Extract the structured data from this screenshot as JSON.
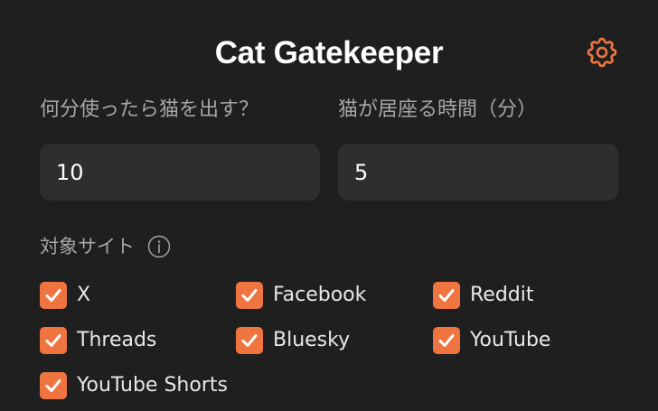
{
  "app": {
    "title": "Cat Gatekeeper",
    "accent_color": "#f07440",
    "settings_icon": "gear-icon"
  },
  "fields": {
    "interval": {
      "label": "何分使ったら猫を出す？",
      "value": "10"
    },
    "duration": {
      "label": "猫が居座る時間（分）",
      "value": "5"
    }
  },
  "sites": {
    "label": "対象サイト",
    "info_icon": "info-icon",
    "items": [
      {
        "label": "X",
        "checked": true
      },
      {
        "label": "Facebook",
        "checked": true
      },
      {
        "label": "Reddit",
        "checked": true
      },
      {
        "label": "Threads",
        "checked": true
      },
      {
        "label": "Bluesky",
        "checked": true
      },
      {
        "label": "YouTube",
        "checked": true
      },
      {
        "label": "YouTube Shorts",
        "checked": true
      }
    ]
  }
}
